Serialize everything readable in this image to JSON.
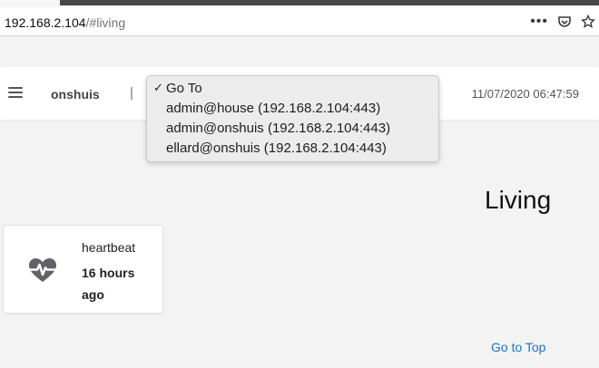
{
  "browser": {
    "url_host": "192.168.2.104",
    "url_path": "/#living"
  },
  "header": {
    "brand": "onshuis",
    "separator": "|",
    "datetime": "11/07/2020 06:47:59"
  },
  "dropdown": {
    "selected": "Go To",
    "items": [
      "admin@house (192.168.2.104:443)",
      "admin@onshuis (192.168.2.104:443)",
      "ellard@onshuis (192.168.2.104:443)"
    ]
  },
  "page": {
    "title": "Living",
    "go_to_top": "Go to Top"
  },
  "card": {
    "name": "heartbeat",
    "value": "16 hours ago",
    "icon": "heartbeat-icon"
  },
  "colors": {
    "link": "#1a73c9",
    "background": "#f3f3f3"
  }
}
